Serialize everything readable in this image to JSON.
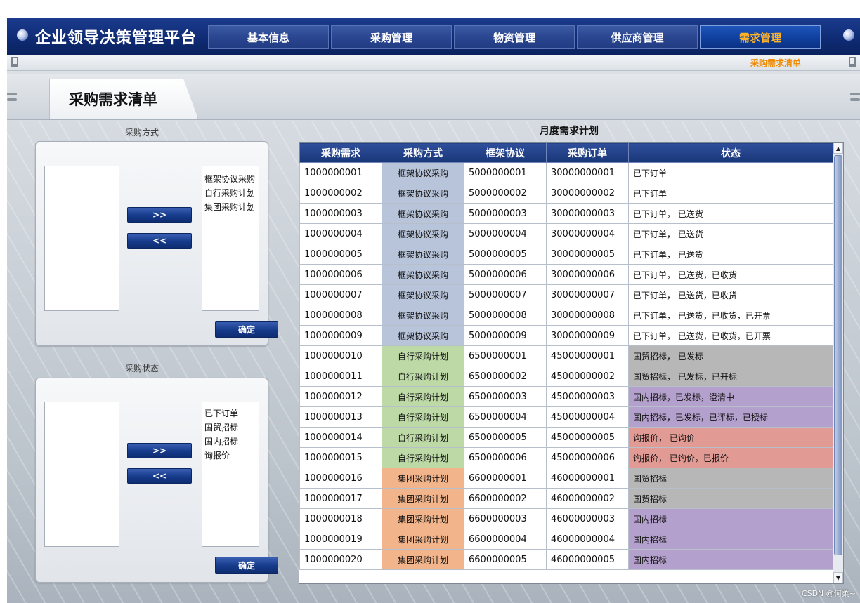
{
  "app": {
    "title": "企业领导决策管理平台"
  },
  "nav": {
    "tabs": [
      "基本信息",
      "采购管理",
      "物资管理",
      "供应商管理",
      "需求管理"
    ],
    "active_index": 4
  },
  "subnav": {
    "link": "采购需求清单"
  },
  "page": {
    "title": "采购需求清单"
  },
  "method_panel": {
    "label": "采购方式",
    "available_options": [],
    "selected_options": [
      "框架协议采购",
      "自行采购计划",
      "集团采购计划"
    ],
    "add_label": ">>",
    "remove_label": "<<",
    "confirm_label": "确定"
  },
  "status_panel": {
    "label": "采购状态",
    "available_options": [],
    "selected_options": [
      "已下订单",
      "国贸招标",
      "国内招标",
      "询报价"
    ],
    "add_label": ">>",
    "remove_label": "<<",
    "confirm_label": "确定"
  },
  "table": {
    "title": "月度需求计划",
    "columns": [
      "采购需求",
      "采购方式",
      "框架协议",
      "采购订单",
      "状态"
    ],
    "rows": [
      [
        "1000000001",
        "框架协议采购",
        "5000000001",
        "30000000001",
        "已下订单"
      ],
      [
        "1000000002",
        "框架协议采购",
        "5000000002",
        "30000000002",
        "已下订单"
      ],
      [
        "1000000003",
        "框架协议采购",
        "5000000003",
        "30000000003",
        "已下订单， 已送货"
      ],
      [
        "1000000004",
        "框架协议采购",
        "5000000004",
        "30000000004",
        "已下订单， 已送货"
      ],
      [
        "1000000005",
        "框架协议采购",
        "5000000005",
        "30000000005",
        "已下订单， 已送货"
      ],
      [
        "1000000006",
        "框架协议采购",
        "5000000006",
        "30000000006",
        "已下订单， 已送货，已收货"
      ],
      [
        "1000000007",
        "框架协议采购",
        "5000000007",
        "30000000007",
        "已下订单， 已送货，已收货"
      ],
      [
        "1000000008",
        "框架协议采购",
        "5000000008",
        "30000000008",
        "已下订单， 已送货，已收货，已开票"
      ],
      [
        "1000000009",
        "框架协议采购",
        "5000000009",
        "30000000009",
        "已下订单， 已送货，已收货，已开票"
      ],
      [
        "1000000010",
        "自行采购计划",
        "6500000001",
        "45000000001",
        "国贸招标， 已发标"
      ],
      [
        "1000000011",
        "自行采购计划",
        "6500000002",
        "45000000002",
        "国贸招标， 已发标，已开标"
      ],
      [
        "1000000012",
        "自行采购计划",
        "6500000003",
        "45000000003",
        "国内招标，已发标，澄清中"
      ],
      [
        "1000000013",
        "自行采购计划",
        "6500000004",
        "45000000004",
        "国内招标，已发标，已评标，已授标"
      ],
      [
        "1000000014",
        "自行采购计划",
        "6500000005",
        "45000000005",
        "询报价， 已询价"
      ],
      [
        "1000000015",
        "自行采购计划",
        "6500000006",
        "45000000006",
        "询报价， 已询价，已报价"
      ],
      [
        "1000000016",
        "集团采购计划",
        "6600000001",
        "46000000001",
        "国贸招标"
      ],
      [
        "1000000017",
        "集团采购计划",
        "6600000002",
        "46000000002",
        "国贸招标"
      ],
      [
        "1000000018",
        "集团采购计划",
        "6600000003",
        "46000000003",
        "国内招标"
      ],
      [
        "1000000019",
        "集团采购计划",
        "6600000004",
        "46000000004",
        "国内招标"
      ],
      [
        "1000000020",
        "集团采购计划",
        "6600000005",
        "46000000005",
        "国内招标"
      ]
    ]
  },
  "colors": {
    "method_framework": "#b7c4da",
    "method_self": "#bcd9a6",
    "method_group": "#f2b48a",
    "status_gray": "#b7b7b7",
    "status_purple": "#b4a0cc",
    "status_red": "#e29a94",
    "active_tab_text": "#ffb428"
  },
  "icons": {
    "logo": "globe-dot-icon",
    "corner": "globe-dot-icon",
    "pin": "pin-icon",
    "scroll_up": "scroll-up-arrow-icon",
    "scroll_down": "scroll-down-arrow-icon"
  },
  "watermark": "CSDN @何柔~"
}
